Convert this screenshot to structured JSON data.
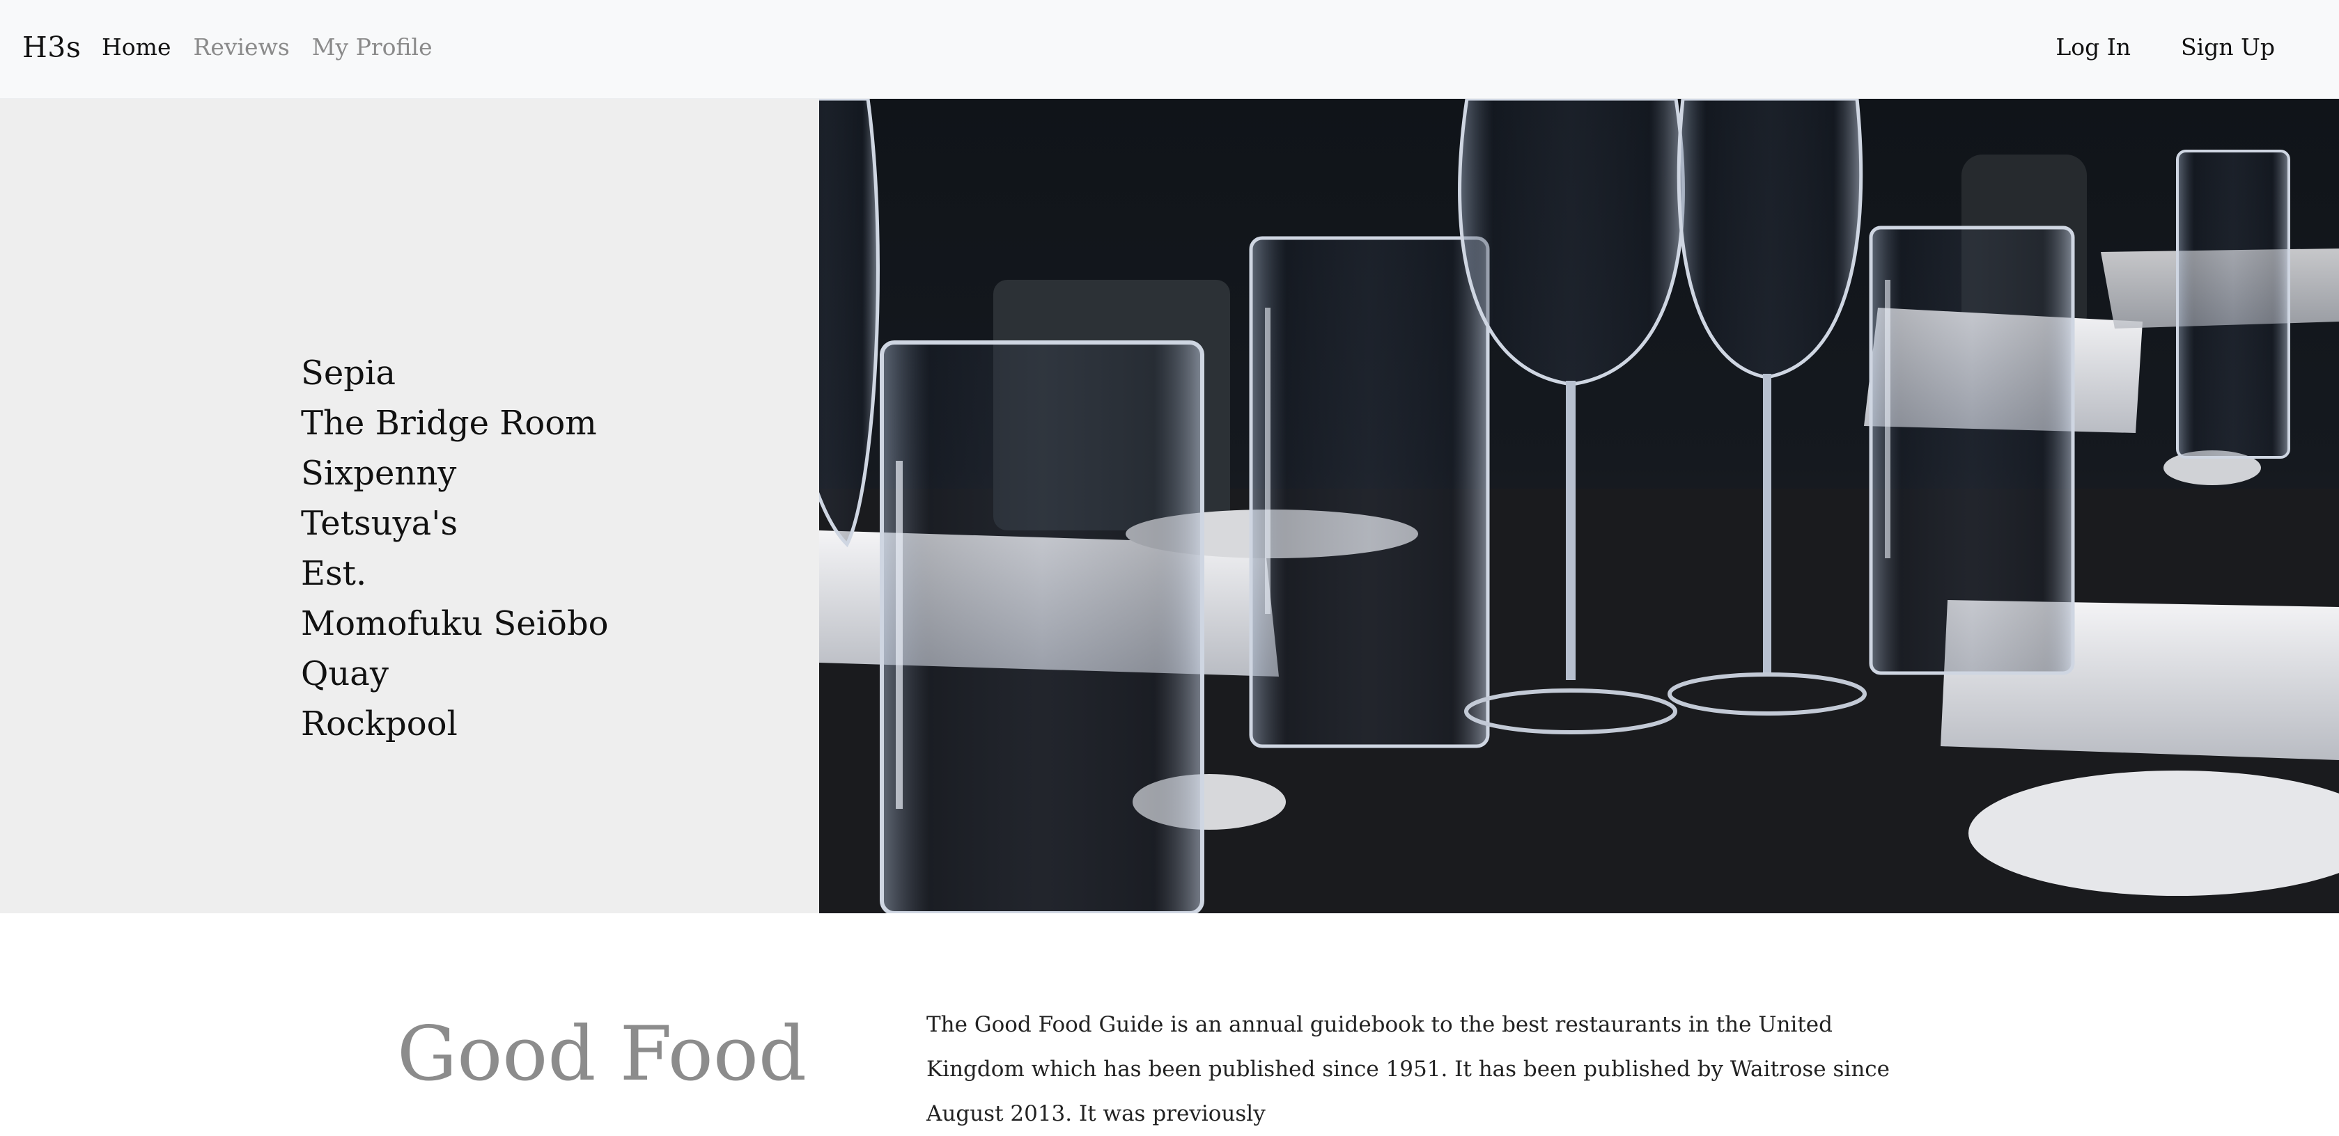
{
  "navbar": {
    "brand": "H3s",
    "links": [
      {
        "label": "Home",
        "active": true
      },
      {
        "label": "Reviews",
        "active": false
      },
      {
        "label": "My Profile",
        "active": false
      }
    ],
    "login_label": "Log In",
    "signup_label": "Sign Up"
  },
  "hero": {
    "restaurants": [
      "Sepia",
      "The Bridge Room",
      "Sixpenny",
      "Tetsuya's",
      "Est.",
      "Momofuku Seiōbo",
      "Quay",
      "Rockpool"
    ]
  },
  "about": {
    "title": "Good Food",
    "text": "The Good Food Guide is an annual guidebook to the best restaurants in the United Kingdom which has been published since 1951. It has been published by Waitrose since August 2013. It was previously"
  },
  "colors": {
    "navbar_bg": "#f8f9fa",
    "hero_left_bg": "#eeeeee",
    "muted_text": "#8a8a8a",
    "title_gray": "#8c8c8c"
  }
}
